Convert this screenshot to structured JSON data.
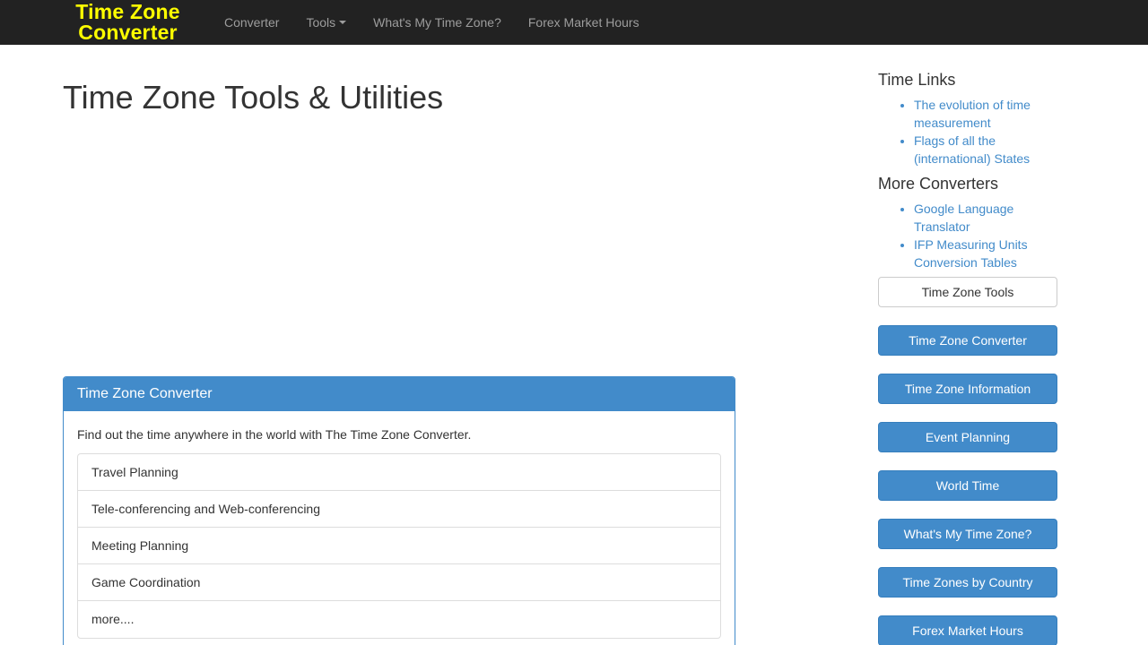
{
  "brand": {
    "line1": "Time Zone",
    "line2": "Converter"
  },
  "nav": {
    "converter": "Converter",
    "tools": "Tools",
    "whats_my_tz": "What's My Time Zone?",
    "forex": "Forex Market Hours"
  },
  "main": {
    "title": "Time Zone Tools & Utilities",
    "panel": {
      "heading": "Time Zone Converter",
      "description": "Find out the time anywhere in the world with The Time Zone Converter.",
      "items": [
        "Travel Planning",
        "Tele-conferencing and Web-conferencing",
        "Meeting Planning",
        "Game Coordination",
        "more...."
      ]
    }
  },
  "sidebar": {
    "time_links": {
      "heading": "Time Links",
      "links": [
        "The evolution of time measurement",
        "Flags of all the (international) States"
      ]
    },
    "more_converters": {
      "heading": "More Converters",
      "links": [
        "Google Language Translator",
        "IFP Measuring Units Conversion Tables"
      ]
    },
    "tools_button": "Time Zone Tools",
    "buttons": [
      "Time Zone Converter",
      "Time Zone Information",
      "Event Planning",
      "World Time",
      "What's My Time Zone?",
      "Time Zones by Country",
      "Forex Market Hours"
    ]
  },
  "colors": {
    "navbar_bg": "#222222",
    "brand": "#ffff00",
    "primary": "#428bca",
    "link": "#428bca"
  }
}
